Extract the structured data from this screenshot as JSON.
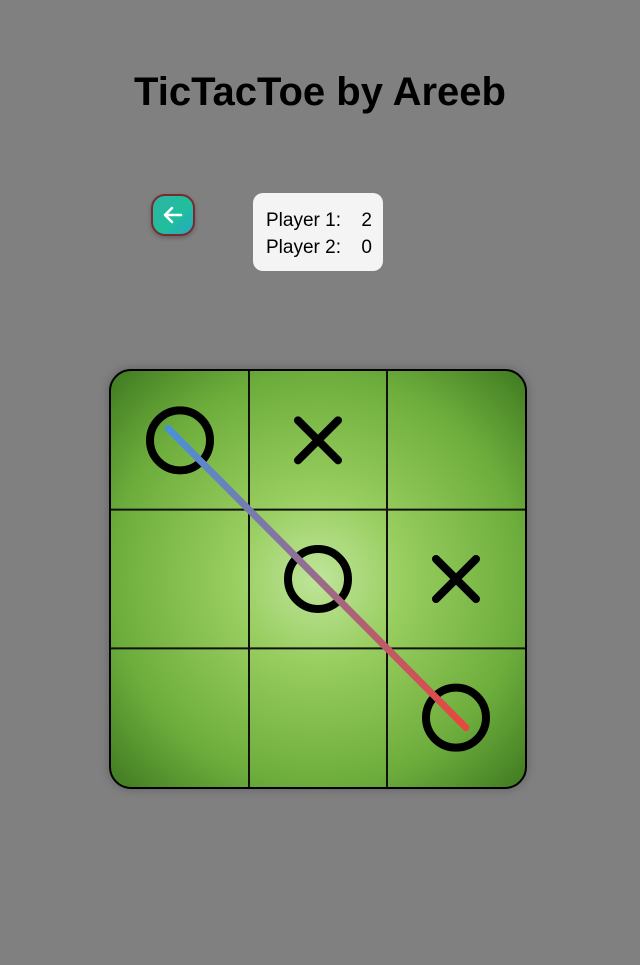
{
  "header": {
    "title": "TicTacToe by Areeb"
  },
  "back_button": {
    "icon": "arrow-left-icon"
  },
  "scoreboard": {
    "player1_label": "Player 1:",
    "player1_score": "2",
    "player2_label": "Player 2:",
    "player2_score": "0"
  },
  "board": {
    "cells": [
      "O",
      "X",
      "",
      "",
      "O",
      "X",
      "",
      "",
      "O"
    ],
    "winning_line": [
      0,
      4,
      8
    ],
    "colors": {
      "line_start": "#4a90d9",
      "line_end": "#e8473f",
      "mark": "#000000"
    }
  }
}
